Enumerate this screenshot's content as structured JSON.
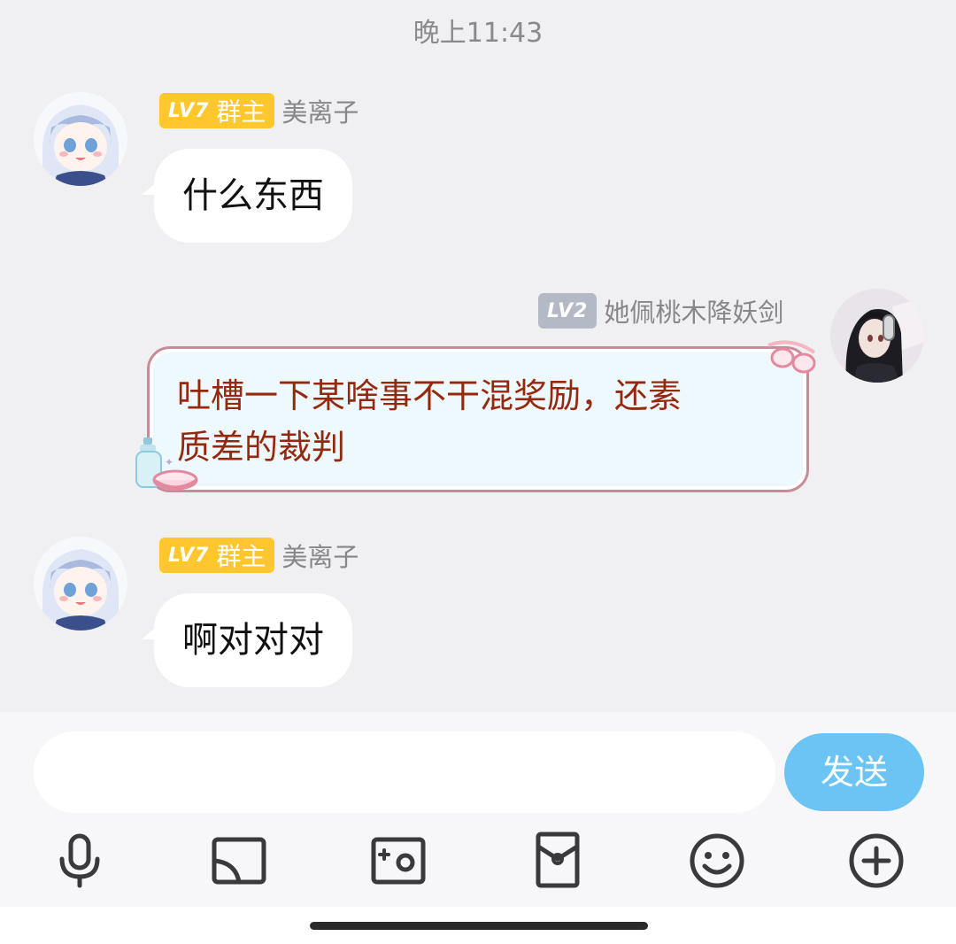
{
  "timestamp": "晚上11:43",
  "messages": [
    {
      "side": "left",
      "badge_level": "LV7",
      "badge_role": "群主",
      "sender": "美离子",
      "text": "什么东西"
    },
    {
      "side": "right",
      "badge_level": "LV2",
      "sender": "她佩桃木降妖剑",
      "text_line1": "吐槽一下某啥事不干混奖励，还素",
      "text_line2": "质差的裁判"
    },
    {
      "side": "left",
      "badge_level": "LV7",
      "badge_role": "群主",
      "sender": "美离子",
      "text": "啊对对对"
    }
  ],
  "input": {
    "placeholder": "",
    "send_label": "发送"
  },
  "toolbar": [
    "mic-icon",
    "screen-cast-icon",
    "photo-icon",
    "red-packet-icon",
    "emoji-icon",
    "plus-icon"
  ],
  "colors": {
    "background": "#f0f0f2",
    "gold_badge": "#ffc72e",
    "grey_badge": "#b3bac6",
    "send_button": "#6bc4f4",
    "fancy_text": "#96280e"
  }
}
